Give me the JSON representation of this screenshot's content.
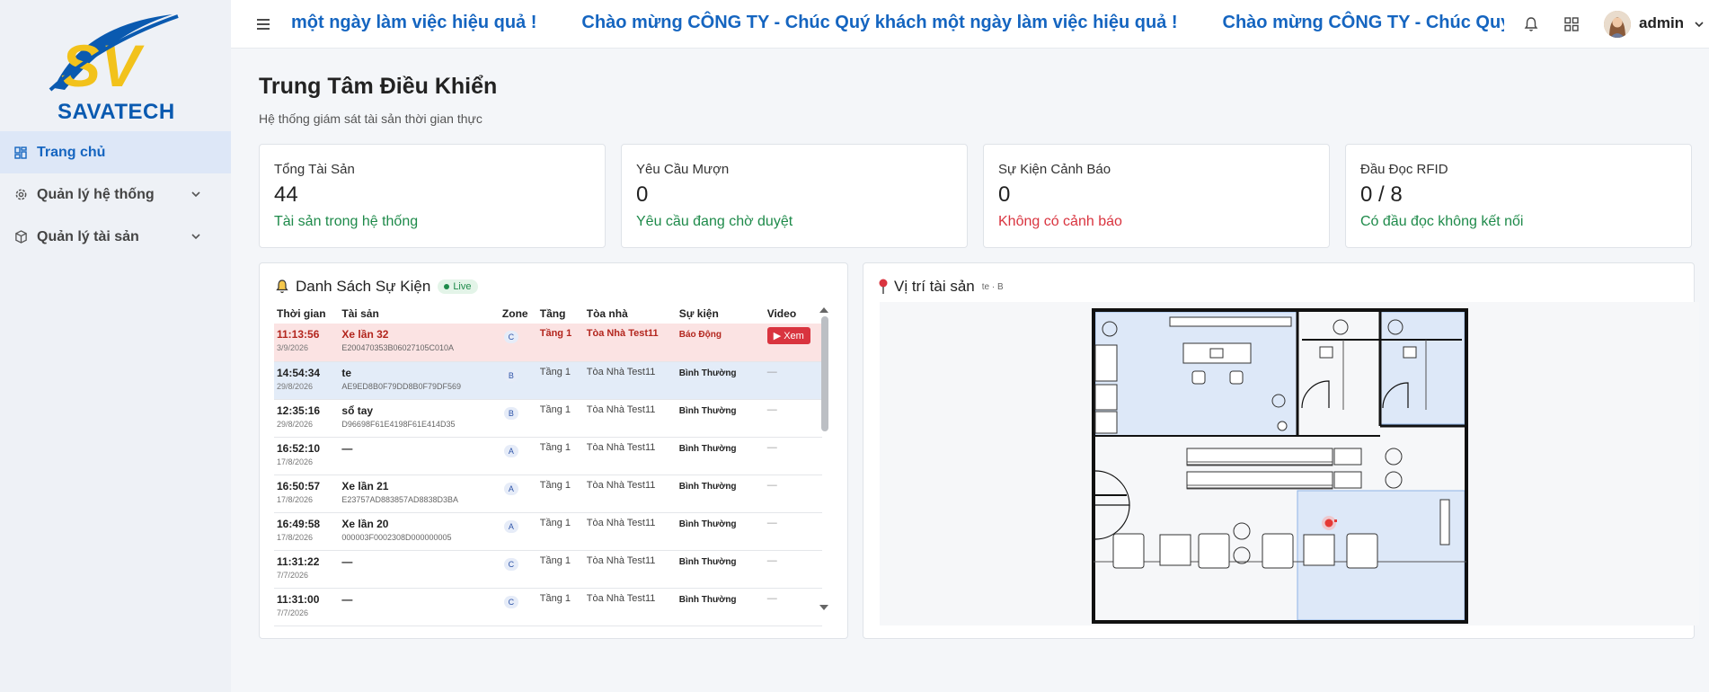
{
  "brand": {
    "name": "SAVATECH",
    "logo_letters": "SV"
  },
  "sidebar": {
    "items": [
      {
        "label": "Trang chủ",
        "icon": "dashboard-icon",
        "active": true
      },
      {
        "label": "Quản lý hệ thống",
        "icon": "gear-icon",
        "expandable": true
      },
      {
        "label": "Quản lý tài sản",
        "icon": "box-icon",
        "expandable": true
      }
    ]
  },
  "header": {
    "marquee": [
      "một ngày làm việc hiệu quả !",
      "Chào mừng CÔNG TY - Chúc Quý khách một ngày làm việc hiệu quả !",
      "Chào mừng CÔNG TY - Chúc Quý khách"
    ],
    "user": "admin"
  },
  "page": {
    "title": "Trung Tâm Điều Khiển",
    "subtitle": "Hệ thống giám sát tài sản thời gian thực"
  },
  "stats": [
    {
      "label": "Tổng Tài Sản",
      "value": "44",
      "sub": "Tài sản trong hệ thống",
      "tone": "green"
    },
    {
      "label": "Yêu Cầu Mượn",
      "value": "0",
      "sub": "Yêu cầu đang chờ duyệt",
      "tone": "green"
    },
    {
      "label": "Sự Kiện Cảnh Báo",
      "value": "0",
      "sub": "Không có cảnh báo",
      "tone": "red"
    },
    {
      "label": "Đầu Đọc RFID",
      "value": "0 / 8",
      "sub": "Có đầu đọc không kết nối",
      "tone": "green"
    }
  ],
  "events": {
    "title": "Danh Sách Sự Kiện",
    "live_label": "Live",
    "columns": [
      "Thời gian",
      "Tài sản",
      "Zone",
      "Tầng",
      "Tòa nhà",
      "Sự kiện",
      "Video"
    ],
    "rows": [
      {
        "time": "11:13:56",
        "date": "3/9/2026",
        "asset": "Xe lần 32",
        "epc": "E200470353B06027105C010A",
        "zone": "C",
        "floor": "Tầng 1",
        "building": "Tòa Nhà Test11",
        "event": "Báo Động",
        "video": "Xem",
        "state": "alarm"
      },
      {
        "time": "14:54:34",
        "date": "29/8/2026",
        "asset": "te",
        "epc": "AE9ED8B0F79DD8B0F79DF569",
        "zone": "B",
        "floor": "Tầng 1",
        "building": "Tòa Nhà Test11",
        "event": "Bình Thường",
        "video": "—",
        "state": "selected"
      },
      {
        "time": "12:35:16",
        "date": "29/8/2026",
        "asset": "sổ tay",
        "epc": "D96698F61E4198F61E414D35",
        "zone": "B",
        "floor": "Tầng 1",
        "building": "Tòa Nhà Test11",
        "event": "Bình Thường",
        "video": "—",
        "state": ""
      },
      {
        "time": "16:52:10",
        "date": "17/8/2026",
        "asset": "—",
        "epc": "",
        "zone": "A",
        "floor": "Tầng 1",
        "building": "Tòa Nhà Test11",
        "event": "Bình Thường",
        "video": "—",
        "state": ""
      },
      {
        "time": "16:50:57",
        "date": "17/8/2026",
        "asset": "Xe lần 21",
        "epc": "E23757AD883857AD8838D3BA",
        "zone": "A",
        "floor": "Tầng 1",
        "building": "Tòa Nhà Test11",
        "event": "Bình Thường",
        "video": "—",
        "state": ""
      },
      {
        "time": "16:49:58",
        "date": "17/8/2026",
        "asset": "Xe lần 20",
        "epc": "000003F0002308D000000005",
        "zone": "A",
        "floor": "Tầng 1",
        "building": "Tòa Nhà Test11",
        "event": "Bình Thường",
        "video": "—",
        "state": ""
      },
      {
        "time": "11:31:22",
        "date": "7/7/2026",
        "asset": "—",
        "epc": "",
        "zone": "C",
        "floor": "Tầng 1",
        "building": "Tòa Nhà Test11",
        "event": "Bình Thường",
        "video": "—",
        "state": ""
      },
      {
        "time": "11:31:00",
        "date": "7/7/2026",
        "asset": "—",
        "epc": "",
        "zone": "C",
        "floor": "Tầng 1",
        "building": "Tòa Nhà Test11",
        "event": "Bình Thường",
        "video": "—",
        "state": ""
      }
    ]
  },
  "map": {
    "title": "Vị trí tài sản",
    "meta": "te · B"
  },
  "colors": {
    "accent": "#1565c0",
    "alarm": "#d9343f",
    "ok": "#1e8a4a"
  }
}
